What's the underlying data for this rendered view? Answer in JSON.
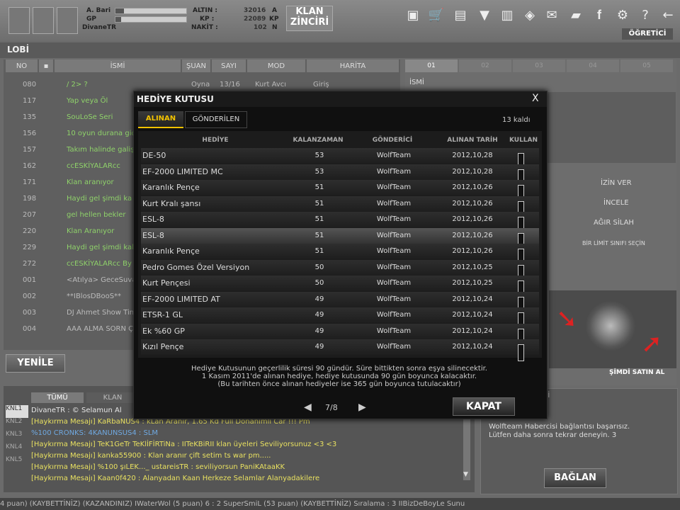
{
  "top": {
    "player_name": "DivaneTR",
    "stats_left": [
      "A. Bari",
      "GP"
    ],
    "stats_right_labels": [
      "ALTIN :",
      "KP :",
      "NAKİT :"
    ],
    "stats_right_values": [
      "32016",
      "22089",
      "102"
    ],
    "stats_right_units": [
      "A",
      "KP",
      "N"
    ],
    "clan_chain": [
      "KLAN",
      "ZİNCİRİ"
    ],
    "ogretici": "ÖĞRETİCİ",
    "icons": [
      "screen-icon",
      "cart-icon",
      "bag-icon",
      "wolf-icon",
      "book-icon",
      "box-icon",
      "mail-icon",
      "folder-icon",
      "facebook-icon",
      "gear-icon",
      "help-icon",
      "back-arrow-icon"
    ]
  },
  "lobi": {
    "title": "LOBİ",
    "headers": [
      "NO",
      "▪",
      "İSMİ",
      "ŞUAN",
      "SAYI",
      "MOD",
      "HARİTA"
    ],
    "rows": [
      {
        "no": "080",
        "name": "/ 2> ?",
        "status": "Oyna",
        "count": "13/16",
        "mode": "Kurt Avcı",
        "map": "Giriş"
      },
      {
        "no": "117",
        "name": "Yap veya Öl"
      },
      {
        "no": "135",
        "name": "SouLoSe    Seri"
      },
      {
        "no": "156",
        "name": "10 oyun durana gidi"
      },
      {
        "no": "157",
        "name": "Takım halinde galiş"
      },
      {
        "no": "162",
        "name": "ccESKİYALARcc"
      },
      {
        "no": "171",
        "name": "Klan aranıyor"
      },
      {
        "no": "198",
        "name": "Haydi gel şimdi ka"
      },
      {
        "no": "207",
        "name": "gel hellen bekler"
      },
      {
        "no": "220",
        "name": "Klan Aranıyor"
      },
      {
        "no": "229",
        "name": "Haydi gel şimdi kaltı"
      },
      {
        "no": "272",
        "name": "ccESKİYALARcc By"
      },
      {
        "no": "001",
        "name": "<Atılya> GeceSuvar"
      },
      {
        "no": "002",
        "name": "**IBlosDBooS**"
      },
      {
        "no": "003",
        "name": "DJ Ahmet Show Tim"
      },
      {
        "no": "004",
        "name": "AAA ALMA SORN Ç"
      }
    ],
    "refresh": "YENİLE"
  },
  "right": {
    "tabs": [
      "01",
      "02",
      "03",
      "04",
      "05"
    ],
    "name_label": "İSMİ",
    "actions": [
      "İZİN VER",
      "İNCELE",
      "AĞIR SİLAH",
      "BİR LİMİT SINIFI SEÇİN"
    ],
    "buy_now": "ŞİMDİ SATIN AL",
    "messenger_title": "ERİ",
    "messenger_text": [
      "Wolfteam Habercisi bağlantısı başarısız.",
      "Lütfen daha sonra tekrar deneyin. 3"
    ],
    "connect": "BAĞLAN"
  },
  "chat": {
    "tabs": [
      "TÜMÜ",
      "KLAN"
    ],
    "channels": [
      "KNL1",
      "KNL2",
      "KNL3",
      "KNL4",
      "KNL5"
    ],
    "lines": [
      {
        "text": "DivaneTR : © Selamun Al",
        "color": "#e6e6e6"
      },
      {
        "text": "[Haykırma Mesajı] KaRbaNUS4 : kLan Aranır, 1.65 Kd Full Donanımlı Car !!! Pm",
        "color": "#e8e060"
      },
      {
        "text": "%100 CRONKS: 4KANUNSUS4 : SLM",
        "color": "#6fa8e0"
      },
      {
        "text": "[Haykırma Mesajı] TeK1GeTr TeKlİFİRTiNa : IITeKBiRII klan üyeleri Seviliyorsunuz <3 <3",
        "color": "#e8e060"
      },
      {
        "text": "[Haykırma Mesajı] kanka55900 : Klan aranır çift setim ts war pm.....",
        "color": "#e8e060"
      },
      {
        "text": "[Haykırma Mesajı] %100 şıLEK..._ ustareisTR : seviliyorsun PaniKAtaaKK",
        "color": "#e8e060"
      },
      {
        "text": "[Haykırma Mesajı] Kaan0f420 : Alanyadan Kaan Herkeze Selamlar Alanyadakilere",
        "color": "#e8e060"
      }
    ]
  },
  "bottom_ticker": "4 puan) (KAYBETTİNİZ)     (KAZANDINIZ) IWaterWol (5 puan) 6 : 2 SuperSmiL (53 puan) (KAYBETTİNİZ)          Sıralama : 3 IIBizDeBoyLe Sunu",
  "modal": {
    "title": "HEDİYE KUTUSU",
    "close": "X",
    "tabs": [
      "ALINAN",
      "GÖNDERİLEN"
    ],
    "remaining": "13 kaldı",
    "columns": [
      "HEDİYE",
      "KALANZAMAN",
      "GÖNDERİCİ",
      "ALINAN TARİH",
      "KULLAN"
    ],
    "rows": [
      {
        "gift": "DE-50",
        "time": "53",
        "sender": "WolfTeam",
        "date": "2012,10,28"
      },
      {
        "gift": "EF-2000 LIMITED MC",
        "time": "53",
        "sender": "WolfTeam",
        "date": "2012,10,28"
      },
      {
        "gift": "Karanlık Pençe",
        "time": "51",
        "sender": "WolfTeam",
        "date": "2012,10,26"
      },
      {
        "gift": "Kurt Kralı şansı",
        "time": "51",
        "sender": "WolfTeam",
        "date": "2012,10,26"
      },
      {
        "gift": "ESL-8",
        "time": "51",
        "sender": "WolfTeam",
        "date": "2012,10,26"
      },
      {
        "gift": "ESL-8",
        "time": "51",
        "sender": "WolfTeam",
        "date": "2012,10,26"
      },
      {
        "gift": "Karanlık Pençe",
        "time": "51",
        "sender": "WolfTeam",
        "date": "2012,10,26"
      },
      {
        "gift": "Pedro Gomes Özel Versiyon",
        "time": "50",
        "sender": "WolfTeam",
        "date": "2012,10,25"
      },
      {
        "gift": "Kurt Pençesi",
        "time": "50",
        "sender": "WolfTeam",
        "date": "2012,10,25"
      },
      {
        "gift": "EF-2000 LIMITED AT",
        "time": "49",
        "sender": "WolfTeam",
        "date": "2012,10,24"
      },
      {
        "gift": "ETSR-1 GL",
        "time": "49",
        "sender": "WolfTeam",
        "date": "2012,10,24"
      },
      {
        "gift": "Ek %60 GP",
        "time": "49",
        "sender": "WolfTeam",
        "date": "2012,10,24"
      },
      {
        "gift": "Kızıl Pençe",
        "time": "49",
        "sender": "WolfTeam",
        "date": "2012,10,24"
      }
    ],
    "note": [
      "Hediye Kutusunun geçerlilik süresi 90 gündür. Süre bittikten sonra eşya silinecektir.",
      "1 Kasım 2011'de alınan hediye, hediye kutusunda 90 gün boyunca kalacaktır.",
      "(Bu tarihten önce alınan hediyeler ise 365 gün boyunca tutulacaktır)"
    ],
    "page": "7/8",
    "kapat": "KAPAT"
  }
}
